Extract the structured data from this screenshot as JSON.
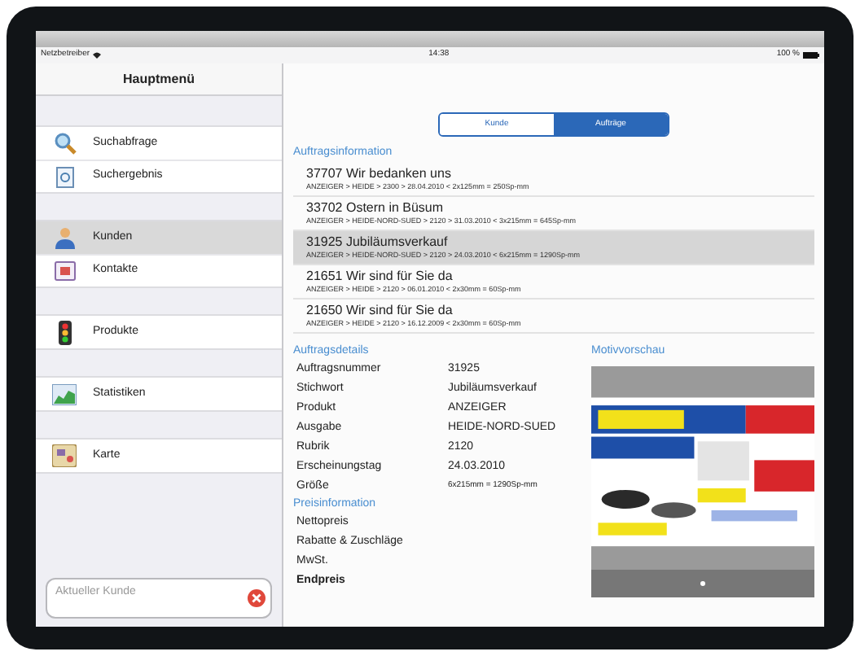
{
  "status_bar": {
    "carrier": "Netzbetreiber",
    "time": "14:38",
    "battery": "100 %"
  },
  "sidebar": {
    "title": "Hauptmenü",
    "groups": [
      [
        {
          "label": "Suchabfrage",
          "kind": "search",
          "selected": false
        },
        {
          "label": "Suchergebnis",
          "kind": "document",
          "selected": false
        }
      ],
      [
        {
          "label": "Kunden",
          "kind": "person",
          "selected": true
        },
        {
          "label": "Kontakte",
          "kind": "calendar",
          "selected": false
        }
      ],
      [
        {
          "label": "Produkte",
          "kind": "traffic",
          "selected": false
        }
      ],
      [
        {
          "label": "Statistiken",
          "kind": "chart",
          "selected": false
        }
      ],
      [
        {
          "label": "Karte",
          "kind": "map",
          "selected": false
        }
      ]
    ],
    "current_customer": {
      "placeholder": "Aktueller Kunde"
    }
  },
  "segments": [
    {
      "label": "Kunde",
      "selected": false
    },
    {
      "label": "Aufträge",
      "selected": true
    }
  ],
  "orders": {
    "heading": "Auftragsinformation",
    "rows": [
      {
        "title": "37707 Wir bedanken uns",
        "detail": "ANZEIGER > HEIDE > 2300 > 28.04.2010 < 2x125mm = 250Sp-mm",
        "selected": false
      },
      {
        "title": "33702 Ostern in Büsum",
        "detail": "ANZEIGER > HEIDE-NORD-SUED > 2120 > 31.03.2010 < 3x215mm = 645Sp-mm",
        "selected": false
      },
      {
        "title": "31925 Jubiläumsverkauf",
        "detail": "ANZEIGER > HEIDE-NORD-SUED > 2120 > 24.03.2010 < 6x215mm = 1290Sp-mm",
        "selected": true
      },
      {
        "title": "21651 Wir sind für Sie da",
        "detail": "ANZEIGER > HEIDE > 2120 > 06.01.2010 < 2x30mm = 60Sp-mm",
        "selected": false
      },
      {
        "title": "21650 Wir sind für Sie da",
        "detail": "ANZEIGER > HEIDE > 2120 > 16.12.2009 < 2x30mm = 60Sp-mm",
        "selected": false
      }
    ]
  },
  "details": {
    "heading": "Auftragsdetails",
    "rows": [
      {
        "label": "Auftragsnummer",
        "value": "31925"
      },
      {
        "label": "Stichwort",
        "value": "Jubiläumsverkauf"
      },
      {
        "label": "Produkt",
        "value": "ANZEIGER"
      },
      {
        "label": "Ausgabe",
        "value": "HEIDE-NORD-SUED"
      },
      {
        "label": "Rubrik",
        "value": "2120"
      },
      {
        "label": "Erscheinungstag",
        "value": "24.03.2010"
      },
      {
        "label": "Größe",
        "value": "6x215mm = 1290Sp-mm"
      }
    ]
  },
  "prices": {
    "heading": "Preisinformation",
    "rows": [
      {
        "label": "Nettopreis",
        "bold": false
      },
      {
        "label": "Rabatte & Zuschläge",
        "bold": false
      },
      {
        "label": "MwSt.",
        "bold": false
      },
      {
        "label": "Endpreis",
        "bold": true
      }
    ]
  },
  "preview": {
    "heading": "Motivvorschau",
    "pages": [
      {
        "selected": true
      }
    ]
  }
}
